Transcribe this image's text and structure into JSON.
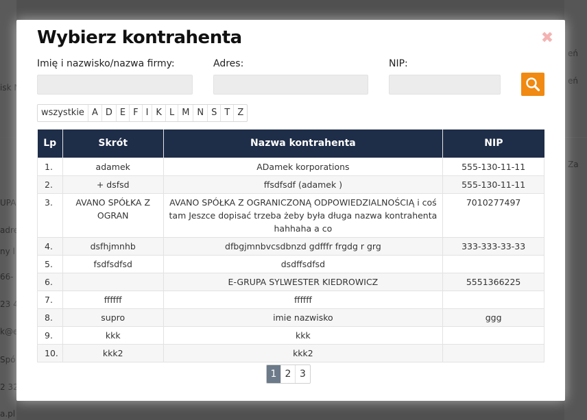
{
  "modal": {
    "title": "Wybierz kontrahenta",
    "close_symbol": "✖"
  },
  "filters": {
    "name_label": "Imię i nazwisko/nazwa firmy:",
    "name_value": "",
    "address_label": "Adres:",
    "address_value": "",
    "nip_label": "NIP:",
    "nip_value": "",
    "search_icon": "search-icon",
    "search_color": "#f08a12"
  },
  "letters": [
    "wszystkie",
    "A",
    "D",
    "E",
    "F",
    "I",
    "K",
    "L",
    "M",
    "N",
    "S",
    "T",
    "Z"
  ],
  "table": {
    "headers": [
      "Lp",
      "Skrót",
      "Nazwa kontrahenta",
      "NIP"
    ],
    "header_color": "#1e2d48",
    "rows": [
      {
        "lp": "1.",
        "skrot": "adamek",
        "nazwa": "ADamek korporations",
        "nip": "555-130-11-11"
      },
      {
        "lp": "2.",
        "skrot": "+ dsfsd",
        "nazwa": "ffsdfsdf (adamek )",
        "nip": "555-130-11-11"
      },
      {
        "lp": "3.",
        "skrot": "AVANO SPÓŁKA Z OGRAN",
        "nazwa": "AVANO SPÓŁKA Z OGRANICZONĄ ODPOWIEDZIALNOŚCIĄ i coś tam Jeszce dopisać trzeba żeby była długa nazwa kontrahenta hahhaha a co",
        "nip": "7010277497"
      },
      {
        "lp": "4.",
        "skrot": "dsfhjmnhb",
        "nazwa": "dfbgjmnbvcsdbnzd gdfffr frgdg r grg",
        "nip": "333-333-33-33"
      },
      {
        "lp": "5.",
        "skrot": "fsdfsdfsd",
        "nazwa": "dsdffsdfsd",
        "nip": ""
      },
      {
        "lp": "6.",
        "skrot": "",
        "nazwa": "E-GRUPA SYLWESTER KIEDROWICZ",
        "nip": "5551366225"
      },
      {
        "lp": "7.",
        "skrot": "ffffff",
        "nazwa": "ffffff",
        "nip": ""
      },
      {
        "lp": "8.",
        "skrot": "supro",
        "nazwa": "imie nazwisko",
        "nip": "ggg"
      },
      {
        "lp": "9.",
        "skrot": "kkk",
        "nazwa": "kkk",
        "nip": ""
      },
      {
        "lp": "10.",
        "skrot": "kkk2",
        "nazwa": "kkk2",
        "nip": ""
      }
    ]
  },
  "pagination": {
    "pages": [
      "1",
      "2",
      "3"
    ],
    "active": "1",
    "active_color": "#6c7a89"
  },
  "background_fragments": {
    "left": [
      "isk N",
      "UPA",
      "adre",
      "ny l",
      "66-",
      "23 4",
      "k@e",
      "Spó",
      "2 32",
      "a.pl"
    ],
    "right": [
      "eń",
      "eń",
      "Za"
    ]
  }
}
